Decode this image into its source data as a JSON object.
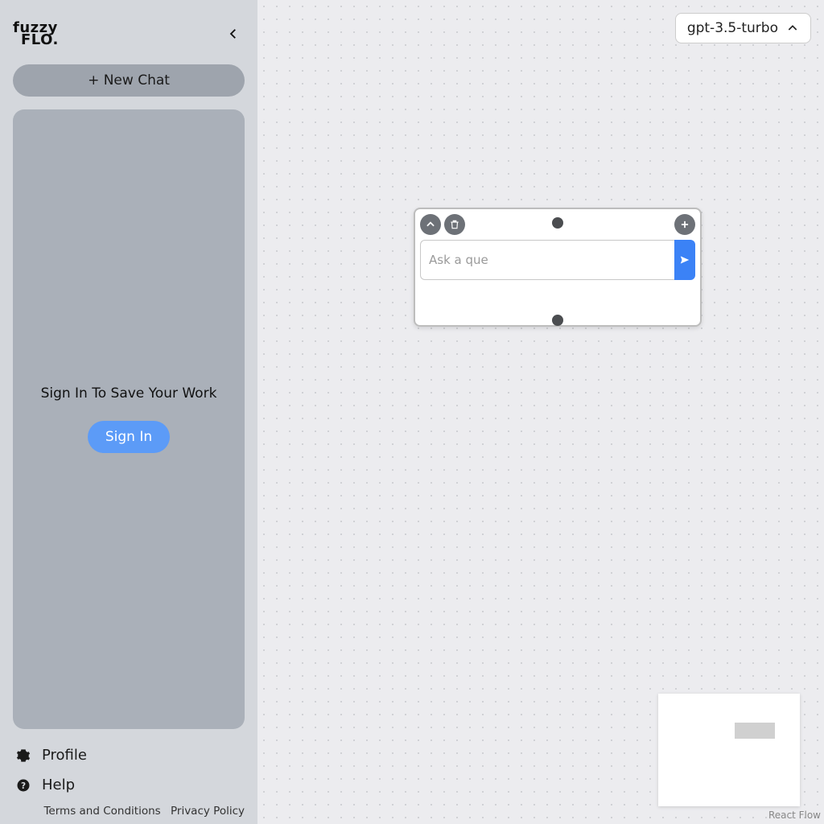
{
  "sidebar": {
    "logo_line1": "fuzzy",
    "logo_line2": "FLO.",
    "new_chat": "+ New Chat",
    "panel_msg": "Sign In To Save Your Work",
    "sign_in": "Sign In",
    "profile": "Profile",
    "help": "Help",
    "terms": "Terms and Conditions",
    "privacy": "Privacy Policy"
  },
  "canvas": {
    "model": "gpt-3.5-turbo",
    "node": {
      "placeholder": "Ask a que"
    },
    "attribution": "React Flow"
  }
}
